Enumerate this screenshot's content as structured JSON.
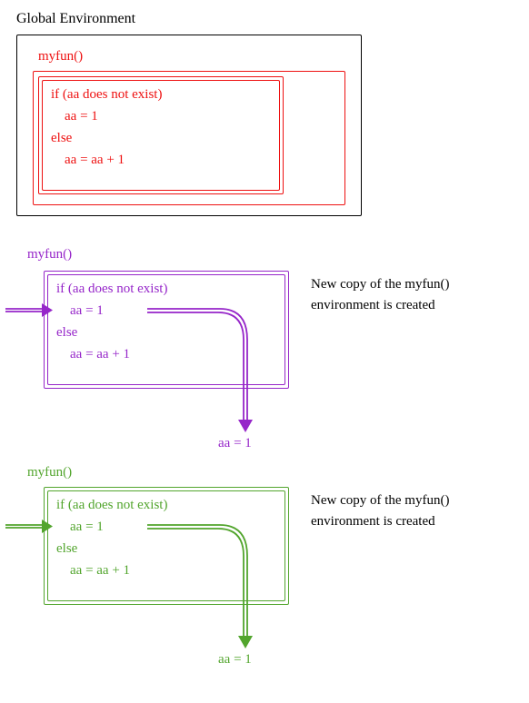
{
  "header": {
    "title": "Global Environment"
  },
  "panel1": {
    "fn_label": "myfun()",
    "code_line1": "if (aa does not exist)",
    "code_line2": "    aa = 1",
    "code_line3": "else",
    "code_line4": "    aa = aa + 1"
  },
  "panel2": {
    "fn_label": "myfun()",
    "code_line1": "if (aa does not exist)",
    "code_line2": "    aa = 1",
    "code_line3": "else",
    "code_line4": "    aa = aa + 1",
    "result": "aa = 1",
    "annotation": "New copy of the myfun()\nenvironment is created"
  },
  "panel3": {
    "fn_label": "myfun()",
    "code_line1": "if (aa does not exist)",
    "code_line2": "    aa = 1",
    "code_line3": "else",
    "code_line4": "    aa = aa + 1",
    "result": "aa = 1",
    "annotation": "New copy of the myfun()\nenvironment is created"
  },
  "colors": {
    "red": "#e11",
    "purple": "#9626c9",
    "green": "#52a52d",
    "black": "#000000"
  }
}
